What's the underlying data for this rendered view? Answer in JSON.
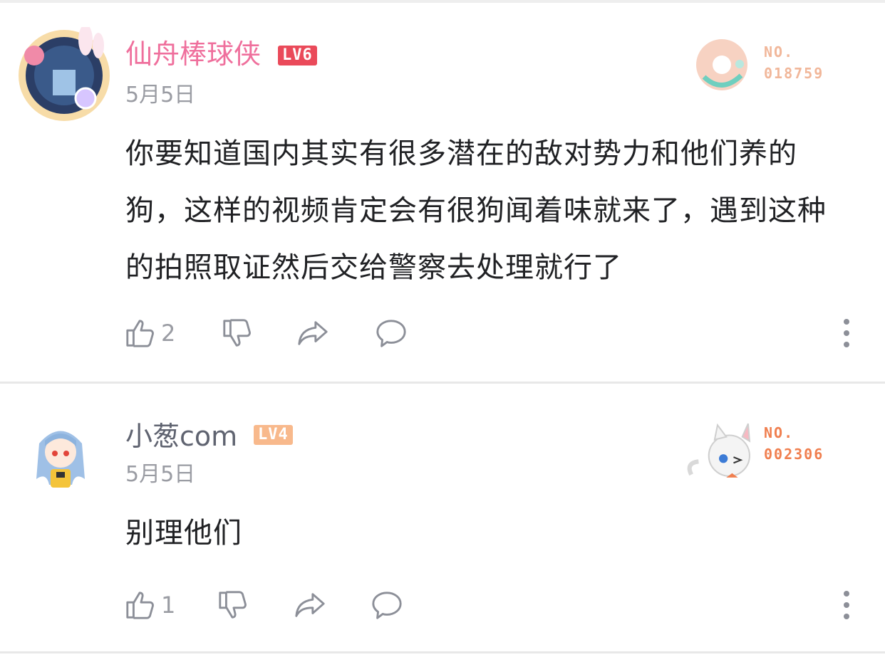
{
  "comments": [
    {
      "username": "仙舟棒球侠",
      "level": "LV6",
      "date": "5月5日",
      "text": "你要知道国内其实有很多潜在的敌对势力和他们养的狗，这样的视频肯定会有很狗闻着味就来了，遇到这种的拍照取证然后交给警察去处理就行了",
      "likes": "2",
      "badge": {
        "label": "NO.",
        "number": "018759"
      }
    },
    {
      "username": "小葱com",
      "level": "LV4",
      "date": "5月5日",
      "text": "别理他们",
      "likes": "1",
      "badge": {
        "label": "NO.",
        "number": "002306"
      }
    }
  ],
  "icons": [
    "thumbs-up-icon",
    "thumbs-down-icon",
    "share-icon",
    "comment-icon",
    "more-icon"
  ],
  "colors": {
    "username_vip": "#ef6f9c",
    "username_normal": "#5f6370",
    "lv6": "#ea4a5a",
    "lv4": "#f8b98c",
    "muted": "#9a9ca3"
  }
}
